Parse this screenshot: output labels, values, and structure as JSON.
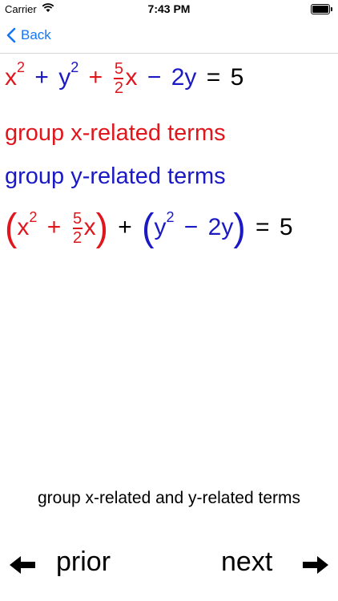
{
  "status_bar": {
    "carrier": "Carrier",
    "time": "7:43 PM"
  },
  "nav": {
    "back_label": "Back"
  },
  "equation_original": {
    "x": "x",
    "x_exp": "2",
    "plus1": "+",
    "y": "y",
    "y_exp": "2",
    "plus2": "+",
    "frac_num": "5",
    "frac_den": "2",
    "x2": "x",
    "minus": "−",
    "coef": "2",
    "y2": "y",
    "equals": "=",
    "rhs": "5"
  },
  "lines": {
    "group_x": "group x-related terms",
    "group_y": "group y-related terms"
  },
  "equation_grouped": {
    "open1": "(",
    "x": "x",
    "x_exp": "2",
    "plus1": "+",
    "frac_num": "5",
    "frac_den": "2",
    "x2": "x",
    "close1": ")",
    "plus_mid": "+",
    "open2": "(",
    "y": "y",
    "y_exp": "2",
    "minus": "−",
    "coef": "2",
    "y2": "y",
    "close2": ")",
    "equals": "=",
    "rhs": "5"
  },
  "caption": "group x-related and y-related terms",
  "footer": {
    "prior_label": "prior",
    "next_label": "next"
  },
  "colors": {
    "x_terms": "#e0161d",
    "y_terms": "#1b19c3",
    "link": "#1476f6"
  }
}
